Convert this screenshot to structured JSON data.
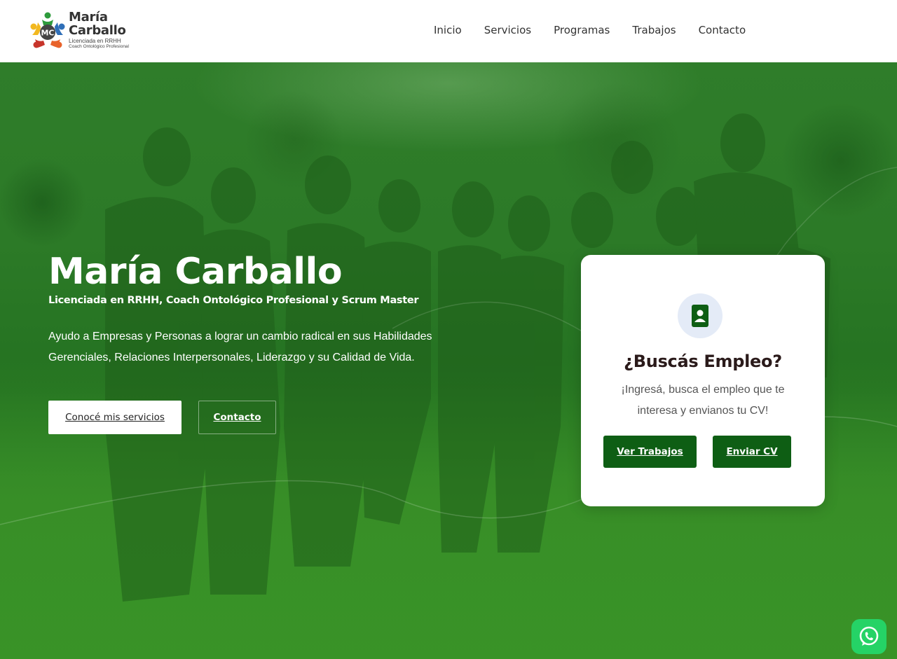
{
  "brand": {
    "name_line1": "María",
    "name_line2": "Carballo",
    "monogram": "MC",
    "sub1": "Licenciada en RRHH",
    "sub2": "Coach Ontológico Profesional"
  },
  "nav": {
    "items": [
      "Inicio",
      "Servicios",
      "Programas",
      "Trabajos",
      "Contacto"
    ]
  },
  "hero": {
    "title": "María Carballo",
    "subtitle": "Licenciada en RRHH, Coach Ontológico Profesional y Scrum Master",
    "description": "Ayudo a Empresas y Personas a lograr un cambio radical en sus Habilidades Gerenciales, Relaciones Interpersonales, Liderazgo y su Calidad de Vida.",
    "primary_button": "Conocé mis servicios",
    "secondary_button": "Contacto"
  },
  "job_card": {
    "icon": "contact-card-icon",
    "title": "¿Buscás Empleo?",
    "text": "¡Ingresá, busca el empleo que te interesa y envianos tu CV!",
    "button_jobs": "Ver Trabajos",
    "button_cv": "Enviar CV"
  },
  "colors": {
    "accent": "#0e5e14",
    "overlay": "#2a7d24"
  },
  "whatsapp": {
    "icon": "whatsapp-icon"
  }
}
